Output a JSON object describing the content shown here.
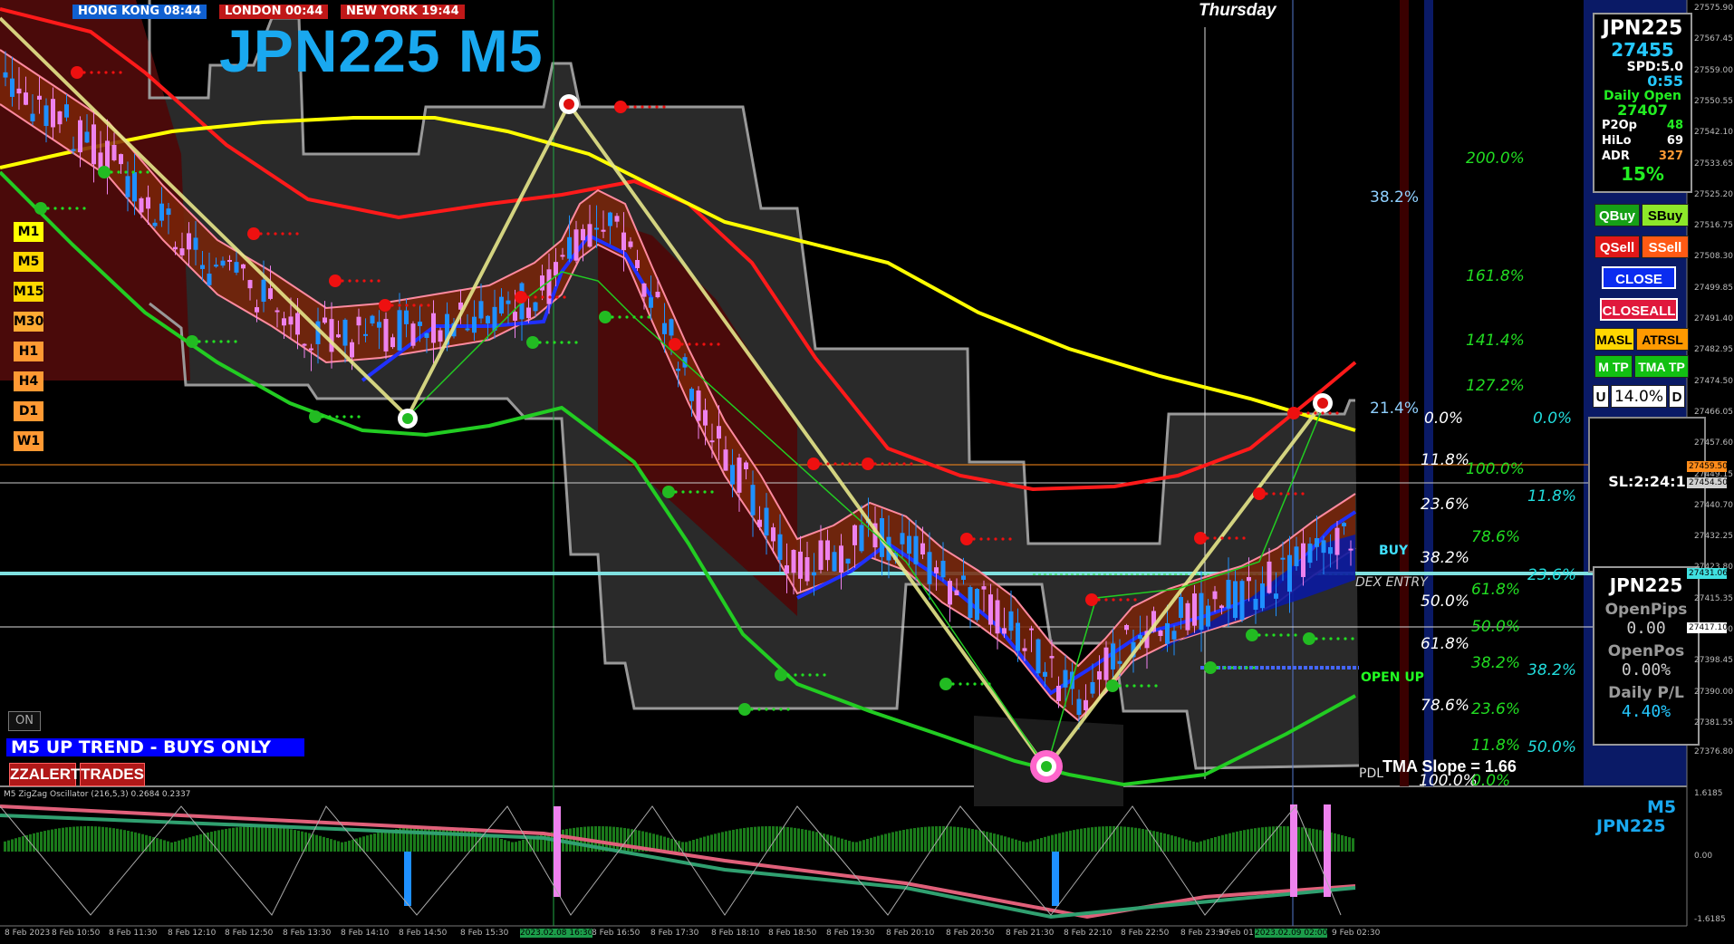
{
  "clocks": [
    {
      "label": "HONG KONG 08:44",
      "color": "#1060d0"
    },
    {
      "label": "LONDON  00:44",
      "color": "#c01818"
    },
    {
      "label": "NEW YORK 19:44",
      "color": "#c01818"
    }
  ],
  "chart_title": "JPN225 M5",
  "day_name": "Thursday",
  "timeframes": [
    {
      "label": "M1",
      "color": "#ffff00"
    },
    {
      "label": "M5",
      "color": "#ffd700"
    },
    {
      "label": "M15",
      "color": "#ffd700"
    },
    {
      "label": "M30",
      "color": "#ffaa33"
    },
    {
      "label": "H1",
      "color": "#ff9933"
    },
    {
      "label": "H4",
      "color": "#ff9933"
    },
    {
      "label": "D1",
      "color": "#ff9933"
    },
    {
      "label": "W1",
      "color": "#ff9933"
    }
  ],
  "on_button": "ON",
  "trend_banner": "M5 UP TREND - BUYS ONLY",
  "buttons": {
    "zzalert": "ZZALERT",
    "trades": "TRADES"
  },
  "chart_labels": {
    "buy": "BUY",
    "dex_entry": "DEX ENTRY",
    "open_up": "OPEN  UP",
    "tma_slope": "TMA Slope = 1.66",
    "pdl": "PDL"
  },
  "fib_left": [
    {
      "label": "38.2%",
      "color": "#8fd0ff"
    },
    {
      "label": "21.4%",
      "color": "#8fd0ff"
    }
  ],
  "fib_white": [
    "0.0%",
    "11.8%",
    "23.6%",
    "38.2%",
    "50.0%",
    "61.8%",
    "78.6%",
    "100.0%"
  ],
  "fib_green": [
    "200.0%",
    "161.8%",
    "141.4%",
    "127.2%",
    "100.0%",
    "78.6%",
    "61.8%",
    "50.0%",
    "38.2%",
    "23.6%",
    "11.8%",
    "0.0%"
  ],
  "fib_cyan": [
    "0.0%",
    "11.8%",
    "23.6%",
    "38.2%",
    "50.0%"
  ],
  "info_panel": {
    "symbol": "JPN225",
    "price": "27455",
    "spread": "SPD:5.0",
    "timer": "0:55",
    "daily_open_label": "Daily Open",
    "daily_open": "27407",
    "p2op_label": "P2Op",
    "p2op": "48",
    "hilo_label": "HiLo",
    "hilo": "69",
    "adr_label": "ADR",
    "adr": "327",
    "adr_pct": "15%"
  },
  "trade_buttons": {
    "qbuy": "QBuy",
    "sbuy": "SBuy",
    "qsell": "QSell",
    "ssell": "SSell",
    "close": "CLOSE",
    "closeall": "CLOSEALL",
    "masl": "MASL",
    "atrsl": "ATRSL",
    "mtp": "M TP",
    "tmatp": "TMA TP",
    "u": "U",
    "risk": "14.0%",
    "d": "D"
  },
  "sl_ratio": "SL:2:24:1",
  "position_panel": {
    "symbol": "JPN225",
    "open_pips_label": "OpenPips",
    "open_pips": "0.00",
    "open_pos_label": "OpenPos",
    "open_pos": "0.00%",
    "daily_pl_label": "Daily P/L",
    "daily_pl": "4.40%"
  },
  "price_axis": [
    "27575.90",
    "27567.45",
    "27559.00",
    "27550.55",
    "27542.10",
    "27533.65",
    "27525.20",
    "27516.75",
    "27508.30",
    "27499.85",
    "27491.40",
    "27482.95",
    "27474.50",
    "27466.05",
    "27457.60",
    "27449.15",
    "27440.70",
    "27432.25",
    "27423.80",
    "27415.35",
    "27406.90",
    "27398.45",
    "27390.00",
    "27381.55",
    "27376.80"
  ],
  "price_tags": [
    {
      "label": "27459.50",
      "color": "#ff8c1a"
    },
    {
      "label": "27454.50",
      "color": "#d0d0d0"
    },
    {
      "label": "27431.06",
      "color": "#40e0e0"
    },
    {
      "label": "27417.10",
      "color": "#ffffff"
    }
  ],
  "oscillator": {
    "title": "M5 ZigZag Oscillator (216,5,3) 0.2684 0.2337",
    "symbol_tf": "M5",
    "symbol": "JPN225",
    "axis": [
      "1.6185",
      "0.00",
      "-1.6185"
    ]
  },
  "time_axis": [
    "8 Feb 2023",
    "8 Feb 10:50",
    "8 Feb 11:30",
    "8 Feb 12:10",
    "8 Feb 12:50",
    "8 Feb 13:30",
    "8 Feb 14:10",
    "8 Feb 14:50",
    "8 Feb 15:30",
    "2023.02.08 16:30",
    "8 Feb 16:50",
    "8 Feb 17:30",
    "8 Feb 18:10",
    "8 Feb 18:50",
    "8 Feb 19:30",
    "8 Feb 20:10",
    "8 Feb 20:50",
    "8 Feb 21:30",
    "8 Feb 22:10",
    "8 Feb 22:50",
    "8 Feb 23:30",
    "9 Feb 01:",
    "2023.02.09 02:00",
    "9 Feb 02:30"
  ],
  "colors": {
    "up_candle": "#1e90ff",
    "down_candle": "#ee82ee",
    "upper_band": "#ff1a1a",
    "lower_band": "#22cc22",
    "ma_long": "#ffff00",
    "zigzag": "#e6e68a",
    "tma": "#0000ff"
  }
}
